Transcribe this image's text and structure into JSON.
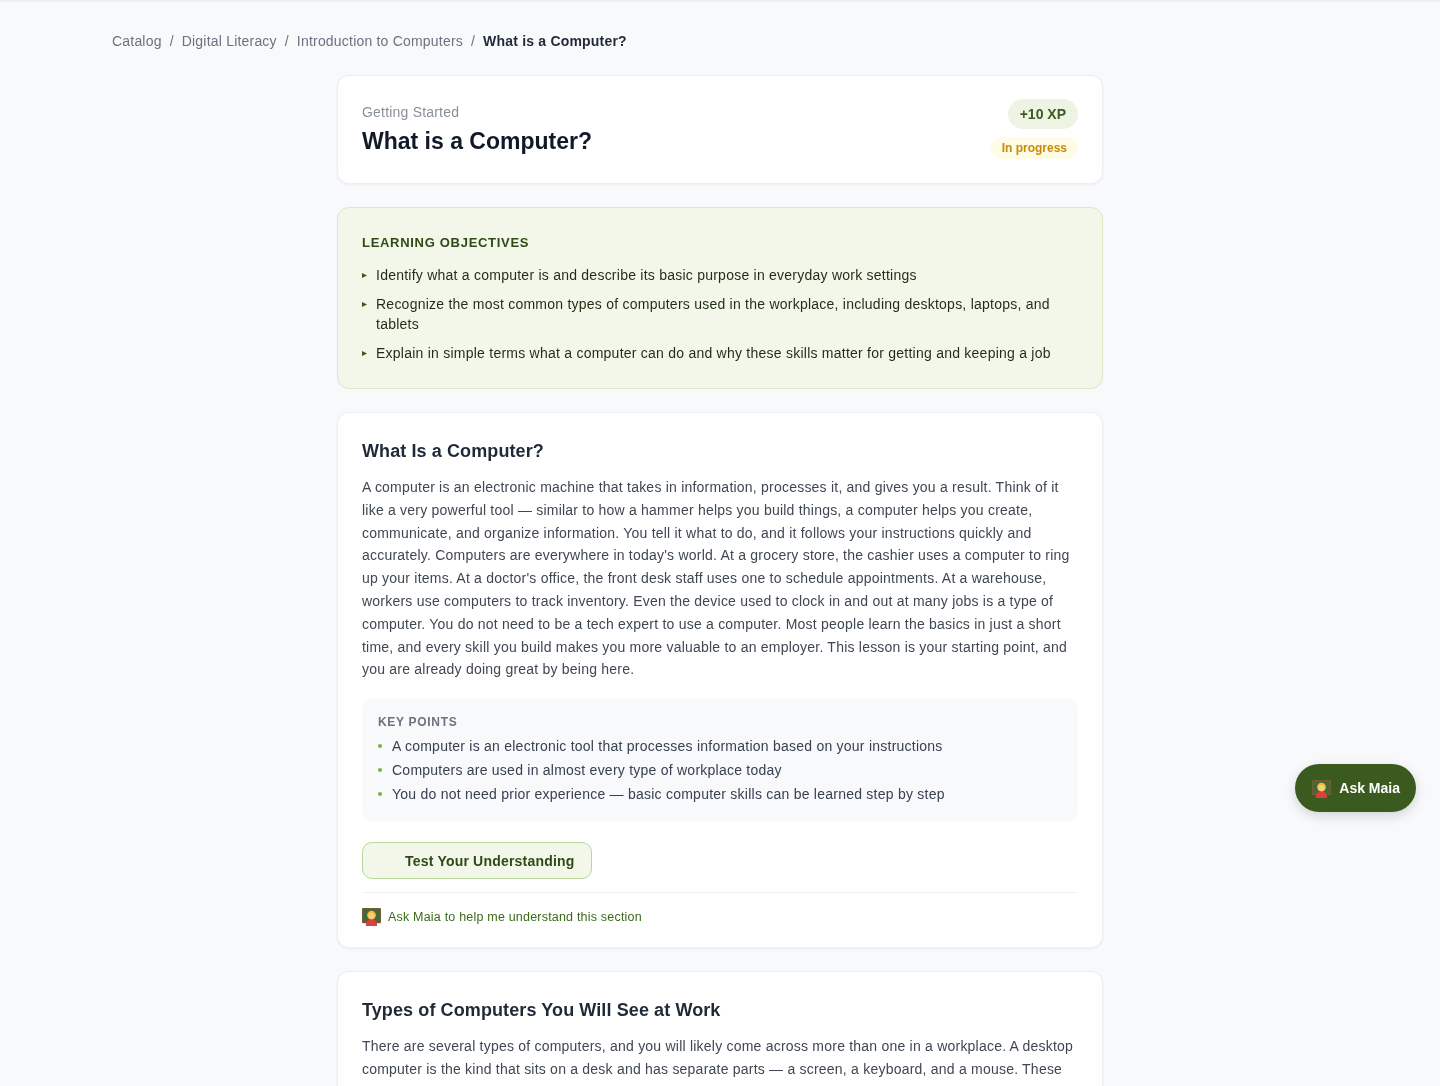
{
  "breadcrumb": [
    {
      "label": "Catalog",
      "current": false
    },
    {
      "separator": "/",
      "label": "Digital Literacy",
      "current": false
    },
    {
      "separator": "/",
      "label": "Introduction to Computers",
      "current": false
    },
    {
      "separator": "/",
      "label": "What is a Computer?",
      "current": true
    }
  ],
  "lesson_header": {
    "eyebrow": "Getting Started",
    "title": "What is a Computer?",
    "xp_badge": "+10 XP",
    "status_badge": "In progress"
  },
  "learning_objectives": {
    "heading": "LEARNING OBJECTIVES",
    "items": [
      "Identify what a computer is and describe its basic purpose in everyday work settings",
      "Recognize the most common types of computers used in the workplace, including desktops, laptops, and tablets",
      "Explain in simple terms what a computer can do and why these skills matter for getting and keeping a job"
    ]
  },
  "sections": [
    {
      "heading": "What Is a Computer?",
      "body": "A computer is an electronic machine that takes in information, processes it, and gives you a result. Think of it like a very powerful tool — similar to how a hammer helps you build things, a computer helps you create, communicate, and organize information. You tell it what to do, and it follows your instructions quickly and accurately. Computers are everywhere in today's world. At a grocery store, the cashier uses a computer to ring up your items. At a doctor's office, the front desk staff uses one to schedule appointments. At a warehouse, workers use computers to track inventory. Even the device used to clock in and out at many jobs is a type of computer. You do not need to be a tech expert to use a computer. Most people learn the basics in just a short time, and every skill you build makes you more valuable to an employer. This lesson is your starting point, and you are already doing great by being here.",
      "key_points": {
        "heading": "KEY POINTS",
        "items": [
          "A computer is an electronic tool that processes information based on your instructions",
          "Computers are used in almost every type of workplace today",
          "You do not need prior experience — basic computer skills can be learned step by step"
        ]
      },
      "quiz_button": "Test Your Understanding",
      "ask_link": "Ask Maia to help me understand this section"
    },
    {
      "heading": "Types of Computers You Will See at Work",
      "body": "There are several types of computers, and you will likely come across more than one in a workplace. A desktop computer is the kind that sits on a desk and has separate parts — a screen, a keyboard, and a mouse. These"
    }
  ],
  "floating_button": {
    "label": "Ask Maia"
  }
}
